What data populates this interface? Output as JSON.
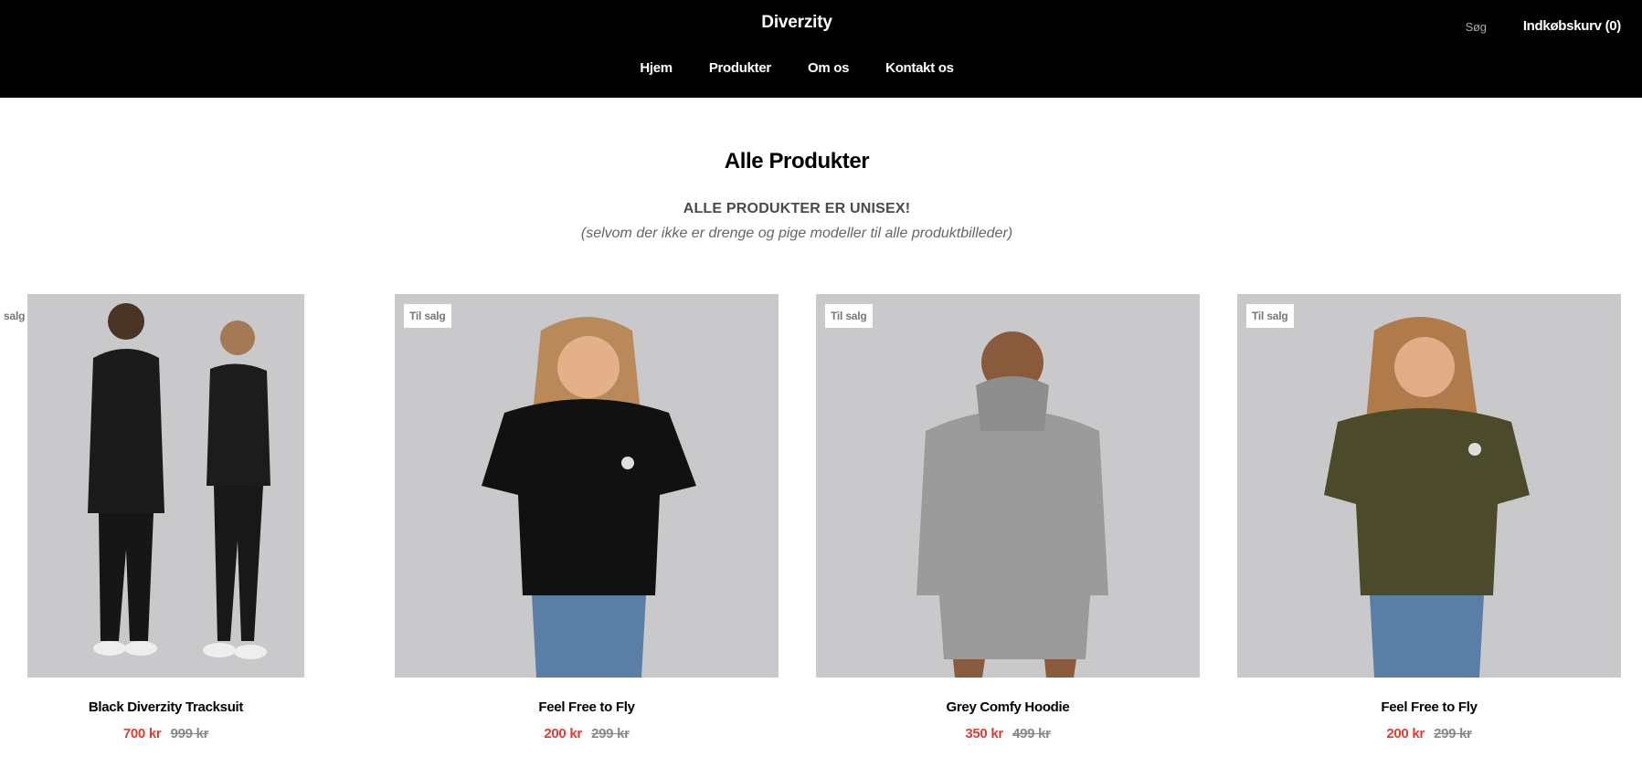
{
  "header": {
    "brand": "Diverzity",
    "nav": [
      "Hjem",
      "Produkter",
      "Om os",
      "Kontakt os"
    ],
    "search_label": "Søg",
    "cart_label": "Indkøbskurv (0)"
  },
  "page": {
    "title": "Alle Produkter",
    "unisex_note": "ALLE PRODUKTER ER UNISEX!",
    "subnote": "(selvom der ikke er drenge og pige modeller til alle produktbilleder)"
  },
  "products": [
    {
      "name": "Black Diverzity Tracksuit",
      "price": "700 kr",
      "old_price": "999 kr",
      "badge": "salg"
    },
    {
      "name": "Feel Free to Fly",
      "price": "200 kr",
      "old_price": "299 kr",
      "badge": "Til salg"
    },
    {
      "name": "Grey Comfy Hoodie",
      "price": "350 kr",
      "old_price": "499 kr",
      "badge": "Til salg"
    },
    {
      "name": "Feel Free to Fly",
      "price": "200 kr",
      "old_price": "299 kr",
      "badge": "Til salg"
    }
  ],
  "colors": {
    "header_bg": "#000000",
    "sale_price": "#e53a30",
    "old_price": "#888888",
    "photo_bg": "#c9c9cb"
  }
}
